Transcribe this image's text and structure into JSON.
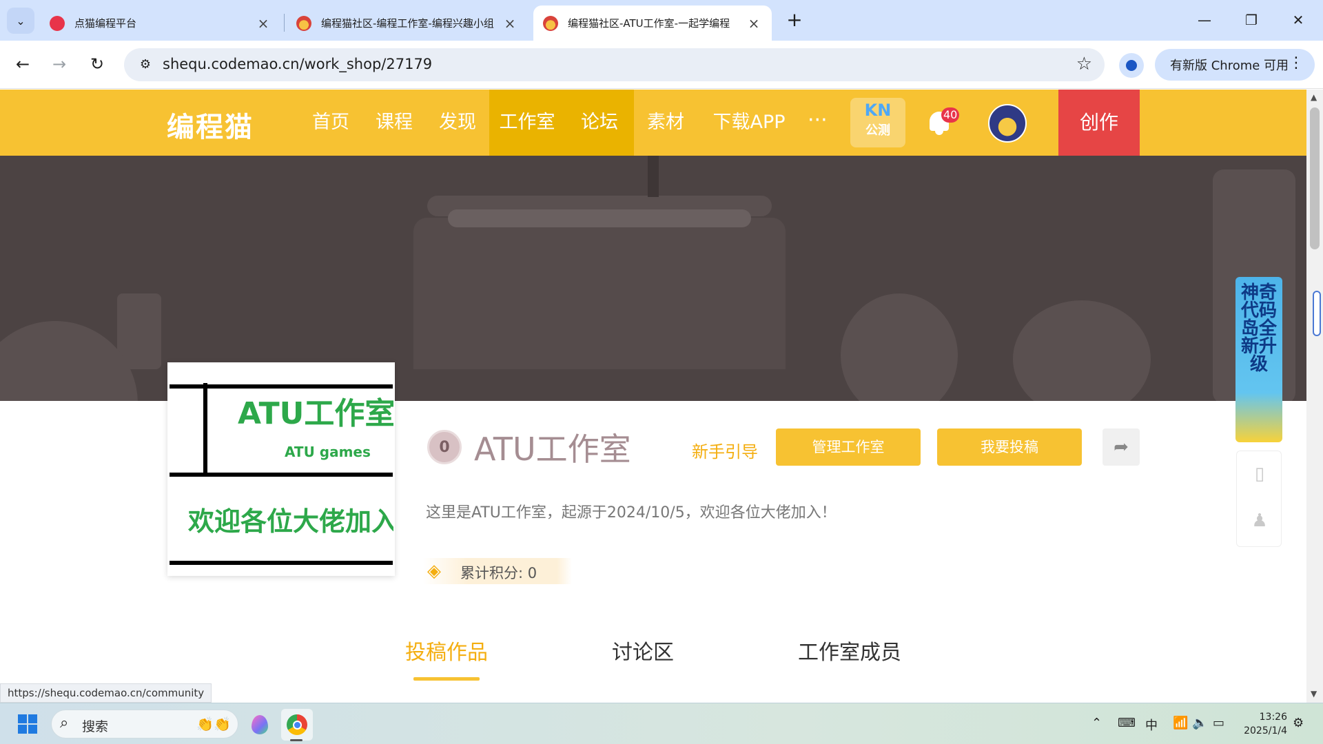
{
  "browser": {
    "tabs": [
      {
        "title": "点猫编程平台",
        "active": false
      },
      {
        "title": "编程猫社区-编程工作室-编程兴趣小组",
        "active": false
      },
      {
        "title": "编程猫社区-ATU工作室-一起学编程",
        "active": true
      }
    ],
    "url": "shequ.codemao.cn/work_shop/27179",
    "update_chip": "有新版 Chrome 可用",
    "status_url": "https://shequ.codemao.cn/community"
  },
  "site": {
    "logo": "编程猫",
    "nav": [
      "首页",
      "课程",
      "发现",
      "工作室",
      "论坛",
      "素材",
      "下载APP"
    ],
    "nav_active": "工作室",
    "more": "···",
    "kn_top": "KN",
    "kn_bottom": "公测",
    "notification_count": "40",
    "create_label": "创作"
  },
  "studio": {
    "cover": {
      "title": "ATU工作室",
      "subtitle": "ATU games",
      "welcome": "欢迎各位大佬加入"
    },
    "level_badge": "0",
    "name": "ATU工作室",
    "guide_link": "新手引导",
    "manage_button": "管理工作室",
    "submit_button": "我要投稿",
    "description": "这里是ATU工作室，起源于2024/10/5，欢迎各位大佬加入！",
    "score_label": "累计积分: 0"
  },
  "tabs": [
    "投稿作品",
    "讨论区",
    "工作室成员"
  ],
  "active_tab": "投稿作品",
  "side_ad": "神奇代码岛全新升级",
  "taskbar": {
    "search_placeholder": "搜索",
    "ime": "中",
    "time": "13:26",
    "date": "2025/1/4"
  },
  "colors": {
    "brand_yellow": "#f7c232",
    "nav_active": "#eab300",
    "create_red": "#e64545",
    "cover_green": "#2da84a",
    "accent_orange": "#f4ae10"
  }
}
